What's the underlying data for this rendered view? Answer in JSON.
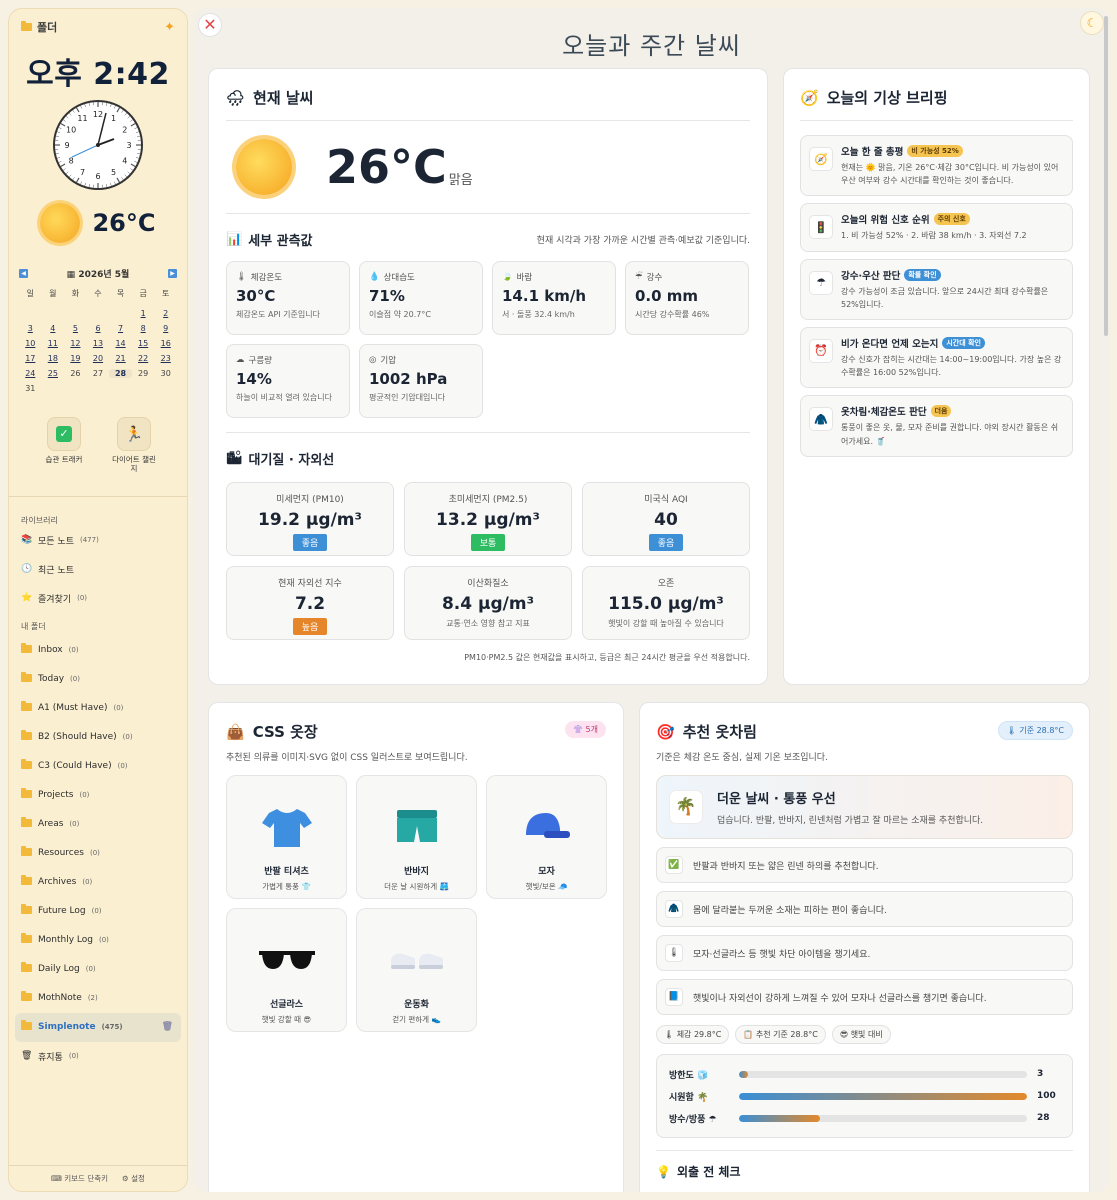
{
  "sidebar": {
    "title": "폴더",
    "time": "오후 2:42",
    "temp": "26°C",
    "calendar": {
      "title": "2026년 5월",
      "weekdays": [
        "일",
        "월",
        "화",
        "수",
        "목",
        "금",
        "토"
      ],
      "days": [
        "",
        "",
        "",
        "",
        "",
        "1",
        "2",
        "3",
        "4",
        "5",
        "6",
        "7",
        "8",
        "9",
        "10",
        "11",
        "12",
        "13",
        "14",
        "15",
        "16",
        "17",
        "18",
        "19",
        "20",
        "21",
        "22",
        "23",
        "24",
        "25",
        "26",
        "27",
        "28",
        "29",
        "30",
        "31"
      ],
      "today": "28"
    },
    "apps": [
      {
        "label": "습관 트래커"
      },
      {
        "label": "다이어트 챌린지"
      }
    ],
    "library_title": "라이브러리",
    "library": [
      {
        "label": "모든 노트",
        "count": "(477)",
        "icon": "📚"
      },
      {
        "label": "최근 노트",
        "count": "",
        "icon": "🕓"
      },
      {
        "label": "즐겨찾기",
        "count": "(0)",
        "icon": "⭐"
      }
    ],
    "folders_title": "내 폴더",
    "folders": [
      {
        "label": "Inbox",
        "count": "(0)"
      },
      {
        "label": "Today",
        "count": "(0)"
      },
      {
        "label": "A1 (Must Have)",
        "count": "(0)"
      },
      {
        "label": "B2 (Should Have)",
        "count": "(0)"
      },
      {
        "label": "C3 (Could Have)",
        "count": "(0)"
      },
      {
        "label": "Projects",
        "count": "(0)"
      },
      {
        "label": "Areas",
        "count": "(0)"
      },
      {
        "label": "Resources",
        "count": "(0)"
      },
      {
        "label": "Archives",
        "count": "(0)"
      },
      {
        "label": "Future Log",
        "count": "(0)"
      },
      {
        "label": "Monthly Log",
        "count": "(0)"
      },
      {
        "label": "Daily Log",
        "count": "(0)"
      },
      {
        "label": "MothNote",
        "count": "(2)"
      },
      {
        "label": "Simplenote",
        "count": "(475)"
      },
      {
        "label": "휴지통",
        "count": "(0)"
      }
    ],
    "footer": {
      "shortcuts": "키보드 단축키",
      "settings": "설정"
    }
  },
  "main": {
    "page_title": "오늘과 주간 날씨",
    "current": {
      "title": "현재 날씨",
      "temp": "26°C",
      "condition": "맑음",
      "details_title": "세부 관측값",
      "details_note": "현재 시각과 가장 가까운 시간별 관측·예보값 기준입니다.",
      "metrics": [
        {
          "icon": "🌡",
          "label": "체감온도",
          "value": "30°C",
          "sub": "체감온도 API 기준입니다"
        },
        {
          "icon": "💧",
          "label": "상대습도",
          "value": "71%",
          "sub": "이슬점 약 20.7°C"
        },
        {
          "icon": "🍃",
          "label": "바람",
          "value": "14.1 km/h",
          "sub": "서 · 돌풍 32.4 km/h"
        },
        {
          "icon": "☔",
          "label": "강수",
          "value": "0.0 mm",
          "sub": "시간당 강수확률 46%"
        },
        {
          "icon": "☁",
          "label": "구름량",
          "value": "14%",
          "sub": "하늘이 비교적 열려 있습니다"
        },
        {
          "icon": "◎",
          "label": "기압",
          "value": "1002 hPa",
          "sub": "평균적인 기압대입니다"
        }
      ],
      "aq_title": "대기질 · 자외선",
      "aq": [
        {
          "label": "미세먼지 (PM10)",
          "value": "19.2 µg/m³",
          "badge": "좋음",
          "badge_color": "#3d8fd6",
          "sub": ""
        },
        {
          "label": "초미세먼지 (PM2.5)",
          "value": "13.2 µg/m³",
          "badge": "보통",
          "badge_color": "#2ebc63",
          "sub": ""
        },
        {
          "label": "미국식 AQI",
          "value": "40",
          "badge": "좋음",
          "badge_color": "#3d8fd6",
          "sub": ""
        },
        {
          "label": "현재 자외선 지수",
          "value": "7.2",
          "badge": "높음",
          "badge_color": "#e6862a",
          "sub": ""
        },
        {
          "label": "이산화질소",
          "value": "8.4 µg/m³",
          "badge": "",
          "badge_color": "",
          "sub": "교통·연소 영향 참고 지표"
        },
        {
          "label": "오존",
          "value": "115.0 µg/m³",
          "badge": "",
          "badge_color": "",
          "sub": "햇빛이 강할 때 높아질 수 있습니다"
        }
      ],
      "aq_note": "PM10·PM2.5 값은 현재값을 표시하고, 등급은 최근 24시간 평균을 우선 적용합니다."
    },
    "briefing": {
      "title": "오늘의 기상 브리핑",
      "items": [
        {
          "icon": "🧭",
          "title": "오늘 한 줄 총평",
          "pill": "비 가능성 52%",
          "pill_bg": "#f6c451",
          "pill_fg": "#5a3a00",
          "desc": "현재는 🌞 맑음, 기온 26°C·체감 30°C입니다. 비 가능성이 있어 우산 여부와 강수 시간대를 확인하는 것이 좋습니다."
        },
        {
          "icon": "🚦",
          "title": "오늘의 위험 신호 순위",
          "pill": "주의 신호",
          "pill_bg": "#f6c451",
          "pill_fg": "#5a3a00",
          "desc": "1. 비 가능성 52% · 2. 바람 38 km/h · 3. 자외선 7.2"
        },
        {
          "icon": "☂",
          "title": "강수·우산 판단",
          "pill": "확률 확인",
          "pill_bg": "#3d8fd6",
          "pill_fg": "#ffffff",
          "desc": "강수 가능성이 조금 있습니다. 앞으로 24시간 최대 강수확률은 52%입니다."
        },
        {
          "icon": "⏰",
          "title": "비가 온다면 언제 오는지",
          "pill": "시간대 확인",
          "pill_bg": "#3d8fd6",
          "pill_fg": "#ffffff",
          "desc": "강수 신호가 잡히는 시간대는 14:00~19:00입니다. 가장 높은 강수확률은 16:00 52%입니다."
        },
        {
          "icon": "🧥",
          "title": "옷차림·체감온도 판단",
          "pill": "더움",
          "pill_bg": "#f6c451",
          "pill_fg": "#5a3a00",
          "desc": "통풍이 좋은 옷, 물, 모자 준비를 권합니다. 야외 장시간 활동은 쉬어가세요. 🥤"
        }
      ]
    },
    "closet": {
      "title": "CSS 옷장",
      "count": "5개",
      "subtitle": "추천된 의류를 이미지·SVG 없이 CSS 일러스트로 보여드립니다.",
      "items": [
        {
          "name": "반팔 티셔츠",
          "desc": "가볍게 통풍 👕"
        },
        {
          "name": "반바지",
          "desc": "더운 날 시원하게 🩳"
        },
        {
          "name": "모자",
          "desc": "햇빛/보온 🧢"
        },
        {
          "name": "선글라스",
          "desc": "햇빛 강할 때 😎"
        },
        {
          "name": "운동화",
          "desc": "걷기 편하게 👟"
        }
      ]
    },
    "outfit": {
      "title": "추천 옷차림",
      "standard": "기준 28.8°C",
      "subtitle": "기준은 체감 온도 중심, 실제 기온 보조입니다.",
      "hot_title": "더운 날씨 · 통풍 우선",
      "hot_desc": "덥습니다. 반팔, 반바지, 린넨처럼 가볍고 잘 마르는 소재를 추천합니다.",
      "recs": [
        {
          "icon": "✅",
          "text": "반팔과 반바지 또는 얇은 린넨 하의를 추천합니다."
        },
        {
          "icon": "🧥",
          "text": "몸에 달라붙는 두꺼운 소재는 피하는 편이 좋습니다."
        },
        {
          "icon": "🌡",
          "text": "모자·선글라스 등 햇빛 차단 아이템을 챙기세요."
        },
        {
          "icon": "📘",
          "text": "햇빛이나 자외선이 강하게 느껴질 수 있어 모자나 선글라스를 챙기면 좋습니다."
        }
      ],
      "tags": [
        "🌡 체감 29.8°C",
        "📋 추천 기준 28.8°C",
        "😎 햇빛 대비"
      ],
      "bars": [
        {
          "label": "방한도 🧊",
          "value": 3
        },
        {
          "label": "시원함 🌴",
          "value": 100
        },
        {
          "label": "방수/방풍 ☂",
          "value": 28
        }
      ],
      "check_title": "외출 전 체크"
    }
  }
}
